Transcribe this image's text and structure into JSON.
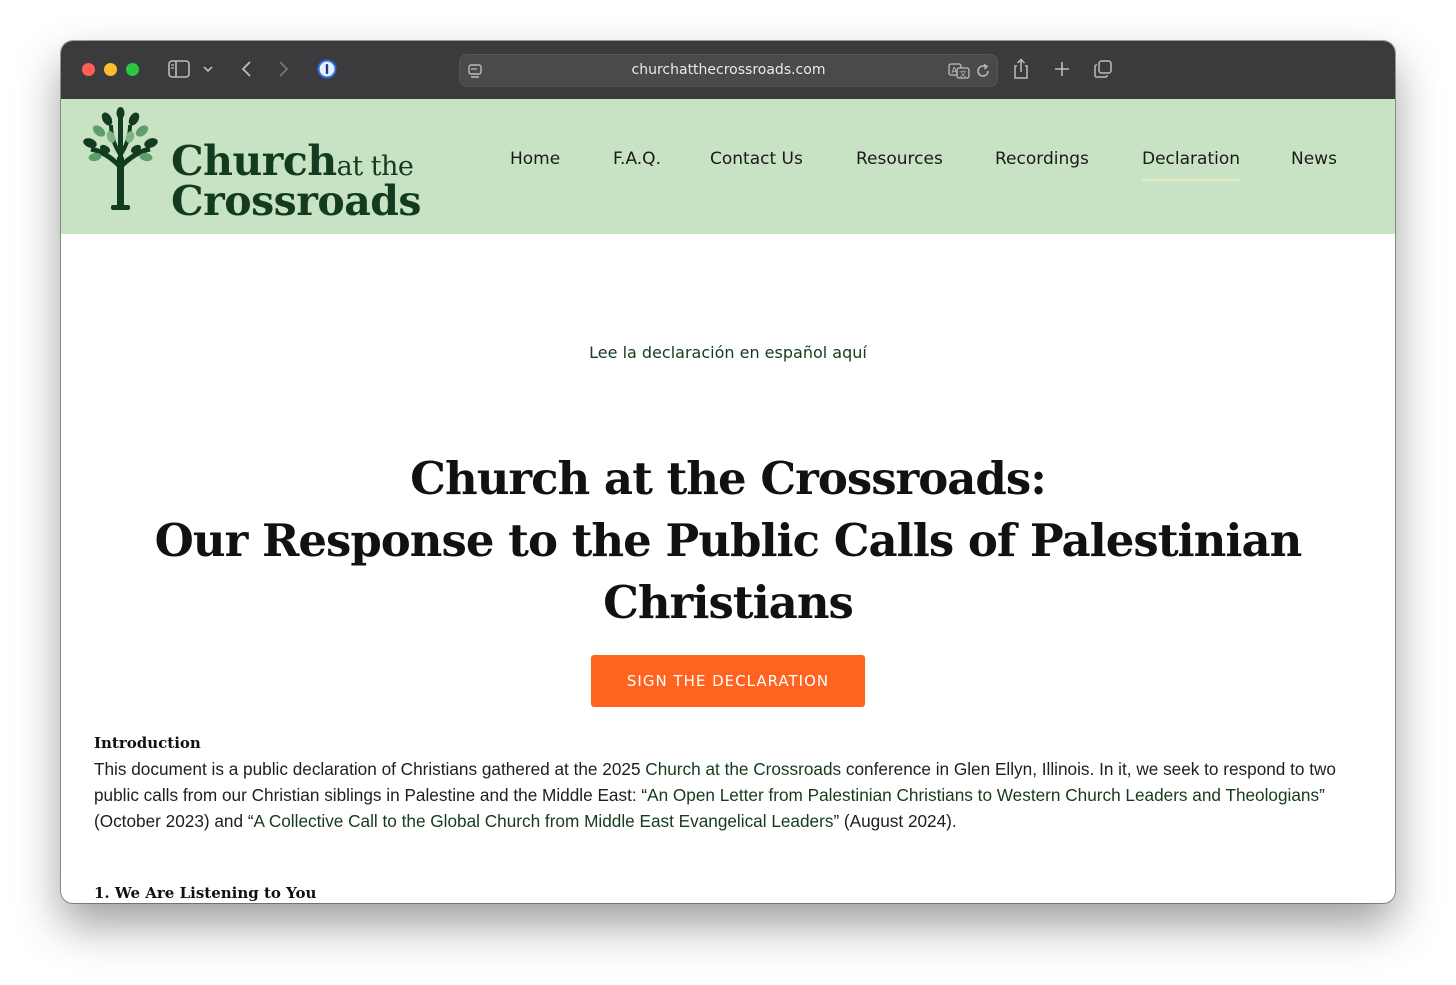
{
  "browser": {
    "url": "churchatthecrossroads.com"
  },
  "site": {
    "logo": {
      "line1_main": "Church",
      "line1_small": "at the",
      "line2": "Crossroads"
    },
    "nav": [
      {
        "label": "Home"
      },
      {
        "label": "F.A.Q."
      },
      {
        "label": "Contact Us"
      },
      {
        "label": "Resources"
      },
      {
        "label": "Recordings"
      },
      {
        "label": "Declaration",
        "active": true
      },
      {
        "label": "News"
      }
    ]
  },
  "main": {
    "spanish_link": "Lee la declaración en español aquí",
    "title_line1": "Church at the Crossroads:",
    "title_line2": "Our Response to the Public Calls of Palestinian Christians",
    "cta_label": "SIGN THE DECLARATION",
    "intro_heading": "Introduction",
    "intro": {
      "t1": "This document is a public declaration of Christians gathered at the 2025 ",
      "link1": "Church at the Crossroads",
      "t2": " conference in Glen Ellyn, Illinois. In it, we seek to respond to two public calls from our Christian siblings in Palestine and the Middle East: “",
      "link2": "An Open Letter from Palestinian Christians to Western Church Leaders and Theologians",
      "t3": "” (October 2023) and “",
      "link3": "A Collective Call to the Global Church from Middle East Evangelical Leaders",
      "t4": "” (August 2024)."
    },
    "section1_heading": "1. We Are Listening to You"
  },
  "colors": {
    "header_bg": "#c8e3c3",
    "brand_dark_green": "#123b1f",
    "cta_orange": "#ff631f",
    "toolbar_bg": "#3b3b3d"
  }
}
